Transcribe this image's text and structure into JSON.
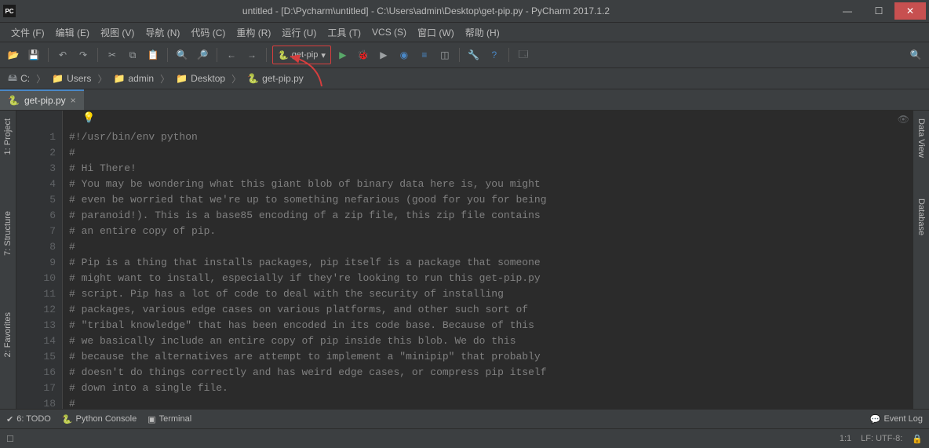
{
  "title": "untitled - [D:\\Pycharm\\untitled] - C:\\Users\\admin\\Desktop\\get-pip.py - PyCharm 2017.1.2",
  "logo_text": "PC",
  "menu": [
    "文件 (F)",
    "编辑 (E)",
    "视图 (V)",
    "导航 (N)",
    "代码 (C)",
    "重构 (R)",
    "运行 (U)",
    "工具 (T)",
    "VCS (S)",
    "窗口 (W)",
    "帮助 (H)"
  ],
  "run_config": "get-pip",
  "breadcrumb": {
    "root": "C:",
    "p1": "Users",
    "p2": "admin",
    "p3": "Desktop",
    "file": "get-pip.py"
  },
  "tab_label": "get-pip.py",
  "left_tabs": [
    "1: Project",
    "7: Structure",
    "2: Favorites"
  ],
  "right_tabs": [
    "Data View",
    "Database"
  ],
  "gutter_start": 1,
  "gutter_end": 18,
  "code_lines": [
    "#!/usr/bin/env python",
    "#",
    "# Hi There!",
    "# You may be wondering what this giant blob of binary data here is, you might",
    "# even be worried that we're up to something nefarious (good for you for being",
    "# paranoid!). This is a base85 encoding of a zip file, this zip file contains",
    "# an entire copy of pip.",
    "#",
    "# Pip is a thing that installs packages, pip itself is a package that someone",
    "# might want to install, especially if they're looking to run this get-pip.py",
    "# script. Pip has a lot of code to deal with the security of installing",
    "# packages, various edge cases on various platforms, and other such sort of",
    "# \"tribal knowledge\" that has been encoded in its code base. Because of this",
    "# we basically include an entire copy of pip inside this blob. We do this",
    "# because the alternatives are attempt to implement a \"minipip\" that probably",
    "# doesn't do things correctly and has weird edge cases, or compress pip itself",
    "# down into a single file.",
    "#"
  ],
  "bottom": {
    "todo": "6: TODO",
    "pyconsole": "Python Console",
    "terminal": "Terminal",
    "eventlog": "Event Log"
  },
  "status": {
    "pos": "1:1",
    "enc": "LF: UTF-8:",
    "lock": "🔒"
  }
}
